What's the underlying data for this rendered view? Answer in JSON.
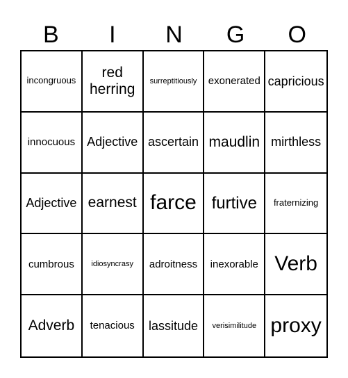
{
  "header": {
    "letters": [
      "B",
      "I",
      "N",
      "G",
      "O"
    ]
  },
  "grid": {
    "rows": [
      [
        "incongruous",
        "red herring",
        "surreptitiously",
        "exonerated",
        "capricious"
      ],
      [
        "innocuous",
        "Adjective",
        "ascertain",
        "maudlin",
        "mirthless"
      ],
      [
        "Adjective",
        "earnest",
        "farce",
        "furtive",
        "fraternizing"
      ],
      [
        "cumbrous",
        "idiosyncrasy",
        "adroitness",
        "inexorable",
        "Verb"
      ],
      [
        "Adverb",
        "tenacious",
        "lassitude",
        "verisimilitude",
        "proxy"
      ]
    ]
  }
}
